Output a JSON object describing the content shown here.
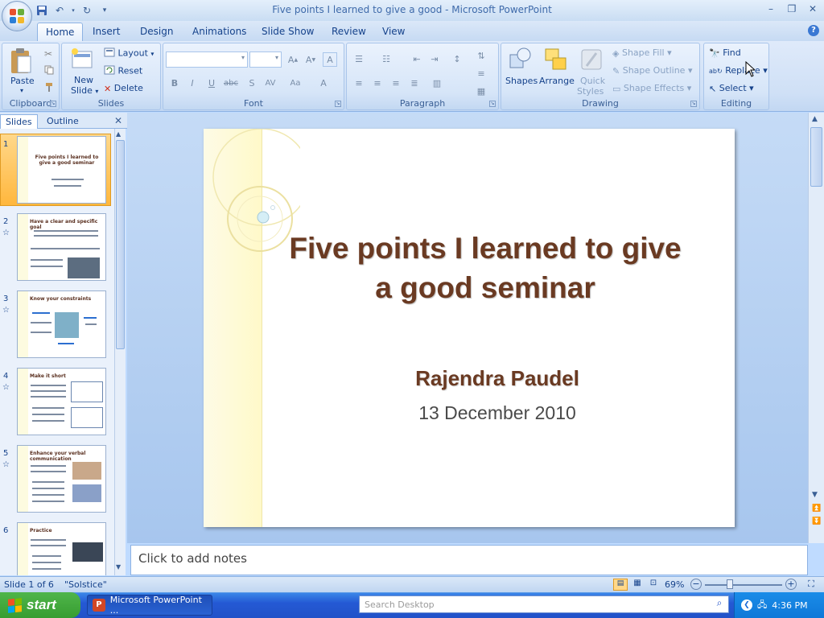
{
  "window": {
    "title": "Five points I learned to give a good - Microsoft PowerPoint"
  },
  "ribbon_tabs": [
    "Home",
    "Insert",
    "Design",
    "Animations",
    "Slide Show",
    "Review",
    "View"
  ],
  "groups": {
    "clipboard": {
      "label": "Clipboard",
      "paste": "Paste"
    },
    "slides": {
      "label": "Slides",
      "new_slide_1": "New",
      "new_slide_2": "Slide",
      "layout": "Layout",
      "reset": "Reset",
      "delete": "Delete"
    },
    "font": {
      "label": "Font"
    },
    "paragraph": {
      "label": "Paragraph"
    },
    "drawing": {
      "label": "Drawing",
      "shapes": "Shapes",
      "arrange": "Arrange",
      "quick_styles_1": "Quick",
      "quick_styles_2": "Styles",
      "shape_fill": "Shape Fill",
      "shape_outline": "Shape Outline",
      "shape_effects": "Shape Effects"
    },
    "editing": {
      "label": "Editing",
      "find": "Find",
      "replace": "Replace",
      "select": "Select"
    }
  },
  "pane": {
    "tab_slides": "Slides",
    "tab_outline": "Outline"
  },
  "thumbnails": [
    {
      "num": "1",
      "title": "Five points I learned to give a good seminar"
    },
    {
      "num": "2",
      "title": "Have a clear and specific goal"
    },
    {
      "num": "3",
      "title": "Know your constraints"
    },
    {
      "num": "4",
      "title": "Make it short"
    },
    {
      "num": "5",
      "title": "Enhance your verbal communication"
    },
    {
      "num": "6",
      "title": "Practice"
    }
  ],
  "slide": {
    "title": "Five points I learned to give a good seminar",
    "author": "Rajendra Paudel",
    "date": "13 December 2010"
  },
  "notes": {
    "placeholder": "Click to add notes"
  },
  "status": {
    "slide": "Slide 1 of 6",
    "theme": "\"Solstice\"",
    "zoom": "69%"
  },
  "taskbar": {
    "start": "start",
    "task": "Microsoft PowerPoint ...",
    "search_placeholder": "Search Desktop",
    "clock": "4:36 PM"
  }
}
